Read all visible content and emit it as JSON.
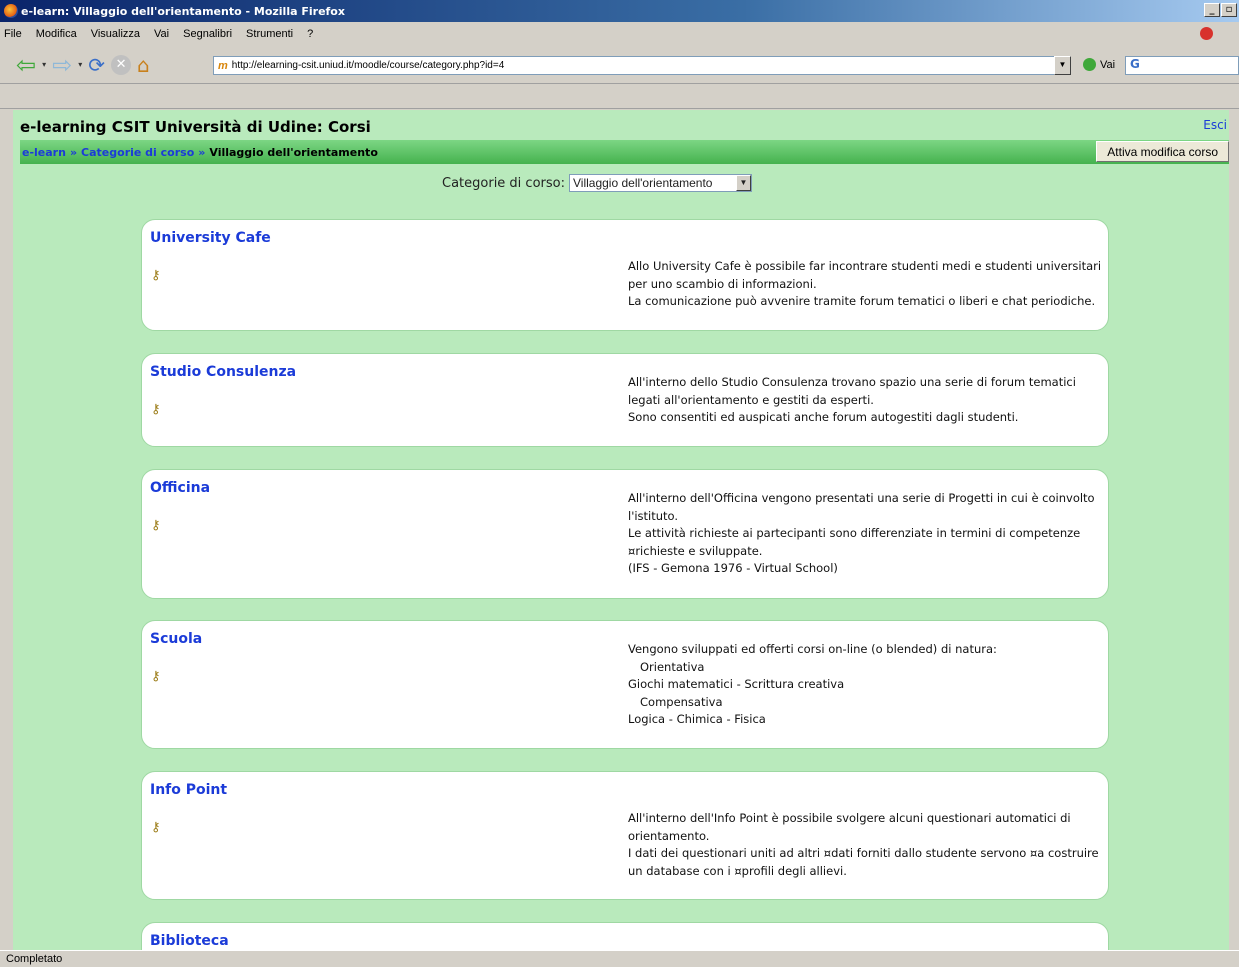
{
  "window": {
    "title": "e-learn: Villaggio dell'orientamento - Mozilla Firefox"
  },
  "menu": [
    "File",
    "Modifica",
    "Visualizza",
    "Vai",
    "Segnalibri",
    "Strumenti",
    "?"
  ],
  "navbar": {
    "url": "http://elearning-csit.uniud.it/moodle/course/category.php?id=4",
    "go_label": "Vai",
    "search_logo": "G"
  },
  "page": {
    "site_title": "e-learning CSIT Università di Udine: Corsi",
    "logout_label": "Esci",
    "breadcrumb": {
      "home": "e-learn",
      "sep": "»",
      "categories": "Categorie di corso",
      "current": "Villaggio dell'orientamento"
    },
    "edit_button": "Attiva modifica corso",
    "category_label": "Categorie di corso:",
    "category_selected": "Villaggio dell'orientamento"
  },
  "courses": [
    {
      "name": "University Cafe",
      "desc": [
        "Allo University Cafe è possibile far incontrare studenti medi e studenti universitari",
        "per uno scambio di informazioni.",
        "La comunicazione può avvenire tramite forum tematici o liberi e chat periodiche."
      ]
    },
    {
      "name": "Studio Consulenza",
      "desc": [
        "All'interno dello Studio Consulenza trovano spazio una serie di forum tematici",
        "legati all'orientamento e gestiti da esperti.",
        "Sono consentiti ed auspicati anche forum autogestiti dagli studenti."
      ]
    },
    {
      "name": "Officina",
      "desc": [
        "All'interno dell'Officina vengono presentati una serie di Progetti in cui è coinvolto",
        "l'istituto.",
        "Le attività richieste ai partecipanti sono differenziate in termini di competenze",
        "¤richieste e sviluppate.",
        "(IFS - Gemona 1976 - Virtual School)"
      ]
    },
    {
      "name": "Scuola",
      "desc": [
        "Vengono sviluppati ed offerti corsi on-line (o blended) di natura:",
        "   Orientativa",
        "Giochi matematici - Scrittura creativa",
        "   Compensativa",
        "Logica - Chimica - Fisica"
      ]
    },
    {
      "name": "Info Point",
      "desc": [
        "All'interno dell'Info Point è possibile svolgere alcuni questionari automatici di",
        "orientamento.",
        "I dati dei questionari uniti ad altri ¤dati forniti dallo studente servono ¤a costruire",
        "un database con i ¤profili degli allievi."
      ]
    },
    {
      "name": "Biblioteca",
      "desc": []
    }
  ],
  "status": "Completato",
  "icons": {
    "course": "key-icon",
    "back": "back-arrow-icon",
    "forward": "forward-arrow-icon",
    "reload": "reload-icon",
    "stop": "stop-icon",
    "home": "home-icon"
  }
}
